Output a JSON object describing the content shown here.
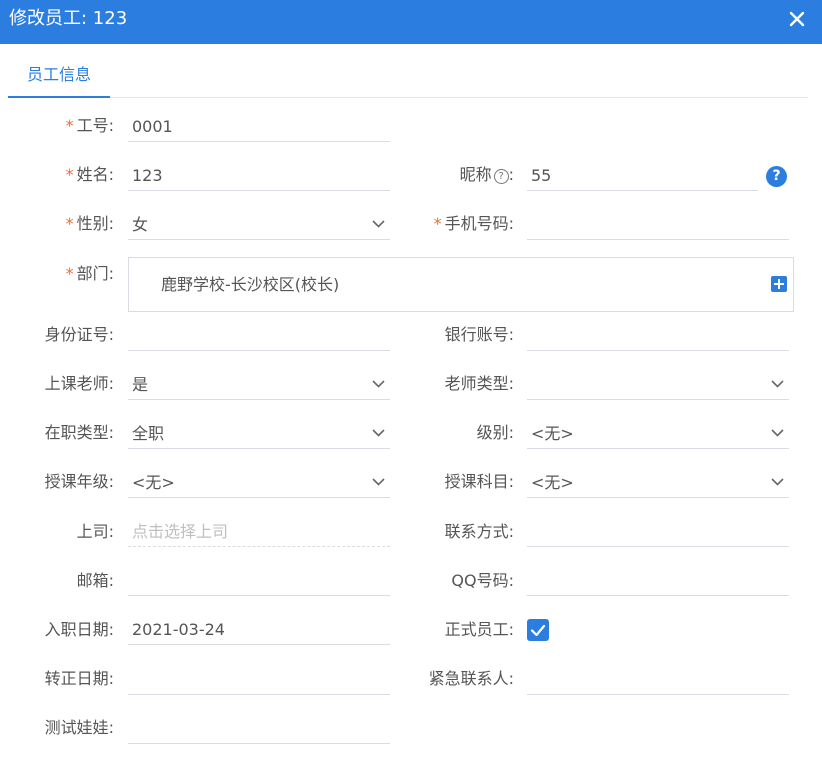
{
  "dialog": {
    "title": "修改员工: 123",
    "close_icon": "close-icon",
    "accent_color": "#2b7ee0",
    "required_color": "#f4693a"
  },
  "tabs": [
    {
      "label": "员工信息",
      "active": true
    }
  ],
  "form": {
    "employee_no": {
      "label": "工号:",
      "value": "0001",
      "required": true
    },
    "name": {
      "label": "姓名:",
      "value": "123",
      "required": true
    },
    "nickname": {
      "label": "昵称",
      "colon": ":",
      "help_icon": "question-circle-icon",
      "value": "55"
    },
    "nickname_help_button": {
      "text": "?"
    },
    "gender": {
      "label": "性别:",
      "value": "女",
      "required": true
    },
    "mobile": {
      "label": "手机号码:",
      "value": "",
      "required": true
    },
    "department": {
      "label": "部门:",
      "value": "鹿野学校-长沙校区(校长)",
      "required": true,
      "add_icon": "plus-square-icon"
    },
    "id_card": {
      "label": "身份证号:",
      "value": ""
    },
    "bank_account": {
      "label": "银行账号:",
      "value": ""
    },
    "is_teacher": {
      "label": "上课老师:",
      "value": "是"
    },
    "teacher_type": {
      "label": "老师类型:",
      "value": ""
    },
    "employment_type": {
      "label": "在职类型:",
      "value": "全职"
    },
    "level": {
      "label": "级别:",
      "value": "<无>"
    },
    "teaching_grade": {
      "label": "授课年级:",
      "value": "<无>"
    },
    "teaching_subject": {
      "label": "授课科目:",
      "value": "<无>"
    },
    "supervisor": {
      "label": "上司:",
      "value": "",
      "placeholder": "点击选择上司"
    },
    "contact": {
      "label": "联系方式:",
      "value": ""
    },
    "email": {
      "label": "邮箱:",
      "value": ""
    },
    "qq": {
      "label": "QQ号码:",
      "value": ""
    },
    "hire_date": {
      "label": "入职日期:",
      "value": "2021-03-24"
    },
    "regular_employee": {
      "label": "正式员工:",
      "checked": true
    },
    "regularization_date": {
      "label": "转正日期:",
      "value": ""
    },
    "emergency_contact": {
      "label": "紧急联系人:",
      "value": ""
    },
    "test_doll": {
      "label": "测试娃娃:",
      "value": ""
    }
  }
}
